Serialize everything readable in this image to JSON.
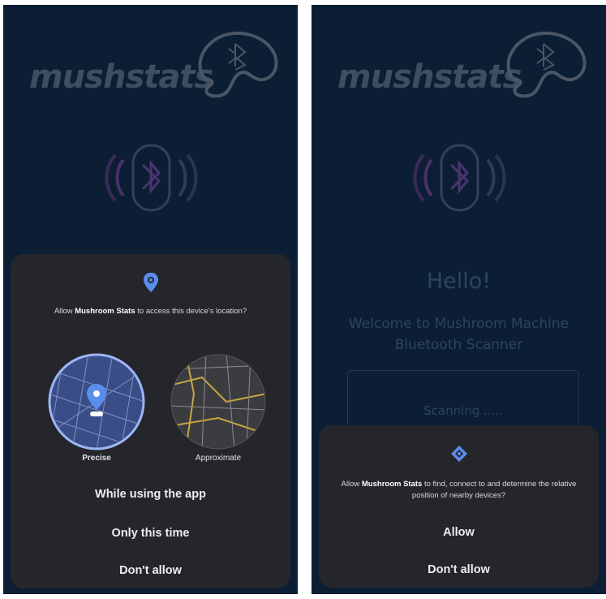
{
  "app": {
    "logo_text": "mushstats",
    "hello": "Hello!",
    "welcome": "Welcome to Mushroom Machine Bluetooth Scanner",
    "scanning": "Scanning ....."
  },
  "location_dialog": {
    "prompt_prefix": "Allow ",
    "app_name": "Mushroom Stats",
    "prompt_suffix": " to access this device's location?",
    "precise_label": "Precise",
    "approximate_label": "Approximate",
    "options": [
      "While using the app",
      "Only this time",
      "Don't allow"
    ]
  },
  "nearby_dialog": {
    "prompt_prefix": "Allow ",
    "app_name": "Mushroom Stats",
    "prompt_suffix": " to find, connect to and determine the relative position of nearby devices?",
    "options": [
      "Allow",
      "Don't allow"
    ]
  },
  "colors": {
    "background": "#0c1e33",
    "sheet": "#25262b",
    "accent": "#5b8def",
    "faded_text": "#2e4460"
  }
}
